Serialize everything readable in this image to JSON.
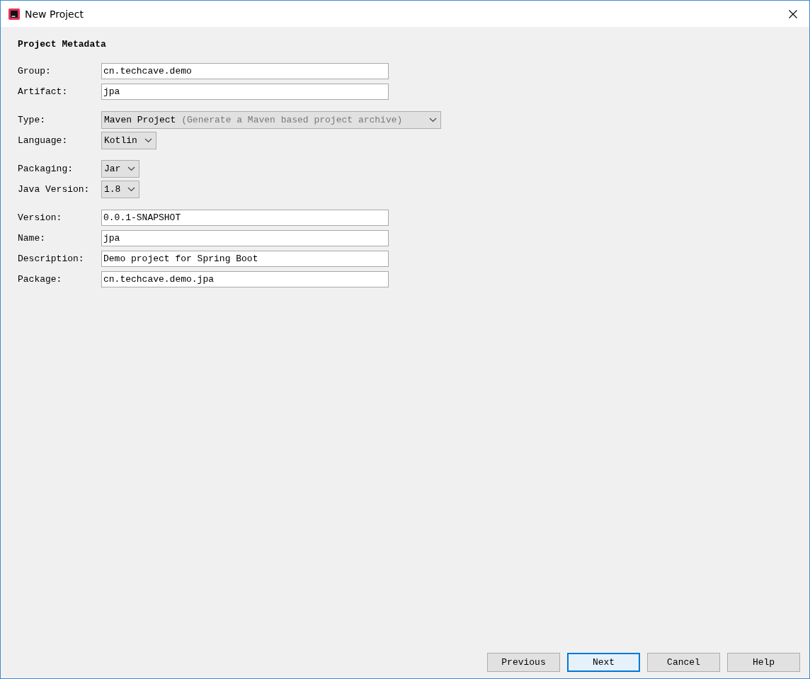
{
  "window": {
    "title": "New Project"
  },
  "section_title": "Project Metadata",
  "groups": [
    {
      "rows": [
        {
          "kind": "text",
          "label": "Group:",
          "value": "cn.techcave.demo"
        },
        {
          "kind": "text",
          "label": "Artifact:",
          "value": "jpa"
        }
      ]
    },
    {
      "rows": [
        {
          "kind": "combo",
          "label": "Type:",
          "value": "Maven Project",
          "hint": "(Generate a Maven based project archive)"
        },
        {
          "kind": "combo",
          "label": "Language:",
          "value": "Kotlin"
        }
      ]
    },
    {
      "rows": [
        {
          "kind": "combo",
          "label": "Packaging:",
          "value": "Jar"
        },
        {
          "kind": "combo",
          "label": "Java Version:",
          "value": "1.8"
        }
      ]
    },
    {
      "rows": [
        {
          "kind": "text",
          "label": "Version:",
          "value": "0.0.1-SNAPSHOT"
        },
        {
          "kind": "text",
          "label": "Name:",
          "value": "jpa"
        },
        {
          "kind": "text",
          "label": "Description:",
          "value": "Demo project for Spring Boot"
        },
        {
          "kind": "text",
          "label": "Package:",
          "value": "cn.techcave.demo.jpa"
        }
      ]
    }
  ],
  "buttons": [
    {
      "label": "Previous",
      "selected": false
    },
    {
      "label": "Next",
      "selected": true
    },
    {
      "label": "Cancel",
      "selected": false
    },
    {
      "label": "Help",
      "selected": false
    }
  ]
}
